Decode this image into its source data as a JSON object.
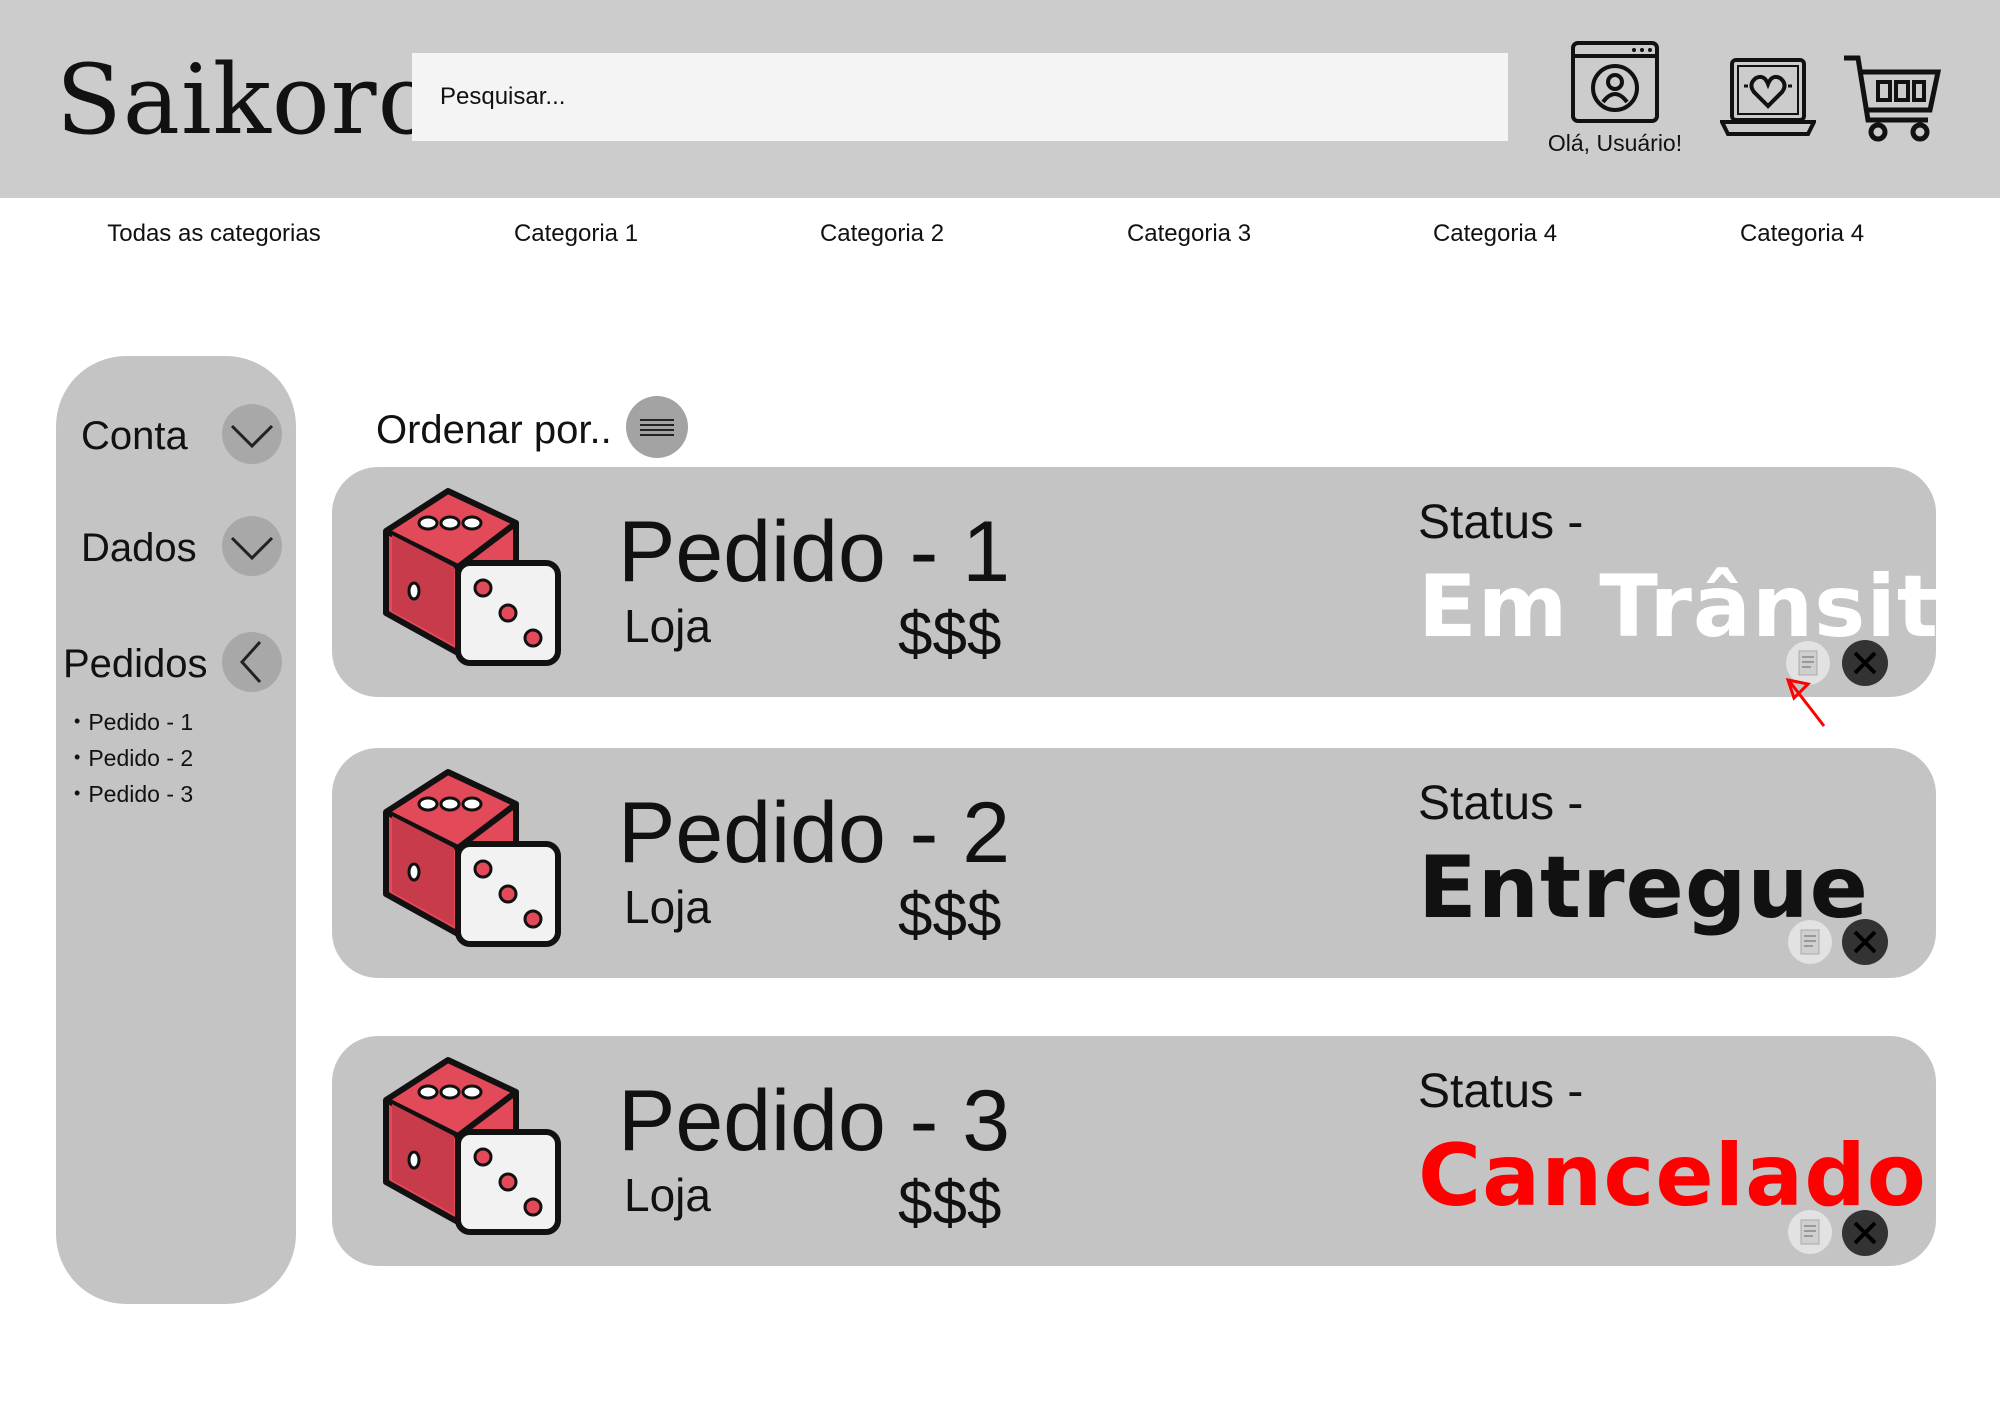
{
  "header": {
    "logo": "Saikoro",
    "search_placeholder": "Pesquisar...",
    "account_greeting": "Olá, Usuário!"
  },
  "categories": [
    "Todas as categorias",
    "Categoria 1",
    "Categoria 2",
    "Categoria 3",
    "Categoria 4",
    "Categoria 4"
  ],
  "sidebar": {
    "account_label": "Conta",
    "data_label": "Dados",
    "orders_label": "Pedidos",
    "orders_list": [
      "Pedido - 1",
      "Pedido - 2",
      "Pedido - 3"
    ]
  },
  "sort": {
    "label": "Ordenar por.."
  },
  "orders": [
    {
      "title": "Pedido - 1",
      "store": "Loja",
      "price": "$$$",
      "status_label": "Status -",
      "status_value": "Em Trânsito",
      "status_color": "#ffffff"
    },
    {
      "title": "Pedido - 2",
      "store": "Loja",
      "price": "$$$",
      "status_label": "Status -",
      "status_value": "Entregue",
      "status_color": "#111111"
    },
    {
      "title": "Pedido - 3",
      "store": "Loja",
      "price": "$$$",
      "status_label": "Status -",
      "status_value": "Cancelado",
      "status_color": "#ff0000"
    }
  ],
  "icons": {
    "account": "account-icon",
    "wishlist": "wishlist-laptop-heart-icon",
    "cart": "shopping-cart-icon",
    "dropdown": "chevron-down-icon",
    "collapse": "chevron-left-icon",
    "sort": "menu-lines-icon",
    "product": "dice-icon",
    "details": "document-icon",
    "cancel": "close-icon",
    "pointer": "red-arrow-icon"
  },
  "colors": {
    "header_bg": "#cccccc",
    "panel_bg": "#c4c4c4",
    "dice_red": "#e24a5a",
    "cancel_red": "#ff0000"
  }
}
